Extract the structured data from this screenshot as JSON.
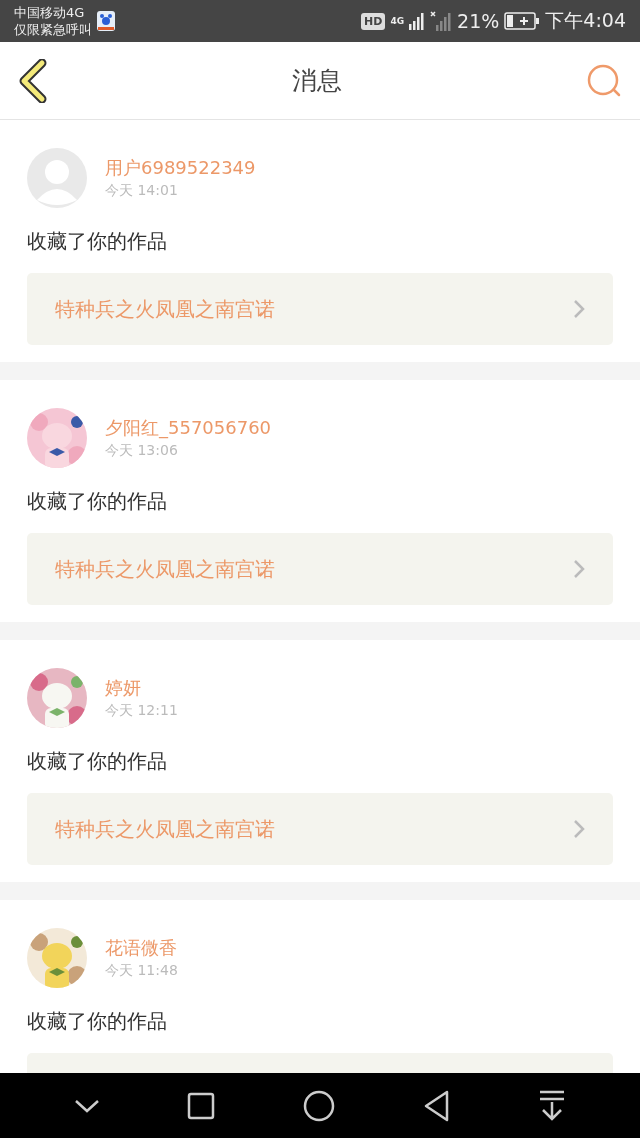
{
  "status_bar": {
    "carrier": "中国移动4G",
    "notice": "仅限紧急呼叫",
    "hd": "HD",
    "network": "4G",
    "battery_text": "21%",
    "time": "下午4:04"
  },
  "header": {
    "title": "消息"
  },
  "messages": [
    {
      "avatar": {
        "kind": "default"
      },
      "name": "用户6989522349",
      "time": "今天 14:01",
      "text": "收藏了你的作品",
      "work": {
        "title": "特种兵之火凤凰之南宫诺"
      }
    },
    {
      "name": "夕阳红_557056760",
      "time": "今天 13:06",
      "text": "收藏了你的作品",
      "work": {
        "title": "特种兵之火凤凰之南宫诺"
      }
    },
    {
      "name": "婷妍",
      "time": "今天 12:11",
      "text": "收藏了你的作品",
      "work": {
        "title": "特种兵之火凤凰之南宫诺"
      }
    },
    {
      "name": "花语微香",
      "time": "今天 11:48",
      "text": "收藏了你的作品"
    }
  ]
}
